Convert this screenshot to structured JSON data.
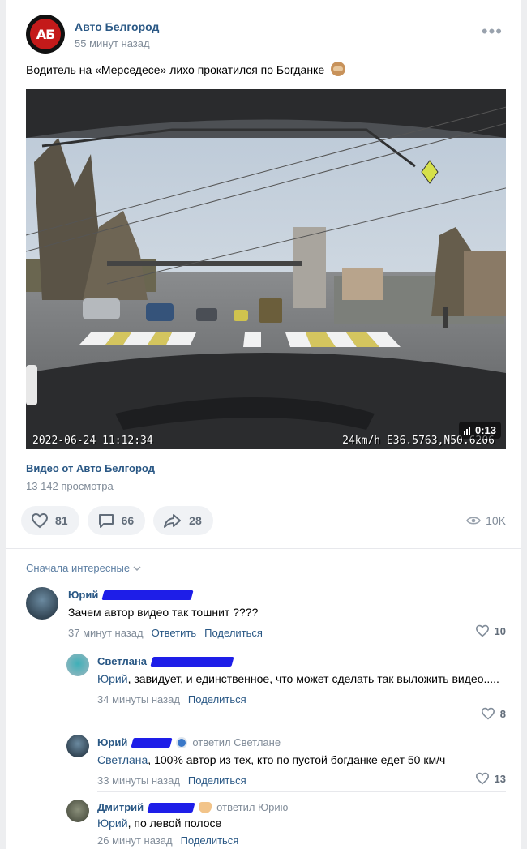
{
  "post": {
    "group_name": "Авто Белгород",
    "time": "55 минут назад",
    "avatar_text": "АБ",
    "text": "Водитель на «Мерседесе» лихо прокатился по Богданке",
    "emoji": "see-no-evil-monkey-icon"
  },
  "video": {
    "osd_date": "2022-06-24 11:12:34",
    "osd_gps": "24km/h E36.5763,N50.6206",
    "duration": "0:13",
    "title": "Видео от Авто Белгород",
    "views": "13 142 просмотра"
  },
  "actions": {
    "likes": "81",
    "comments": "66",
    "shares": "28",
    "views": "10K"
  },
  "comments_sort": "Сначала интересные",
  "comments": [
    {
      "author": "Юрий",
      "text": "Зачем автор видео так тошнит ????",
      "time": "37 минут назад",
      "reply": "Ответить",
      "share": "Поделиться",
      "likes": "10"
    },
    {
      "author": "Светлана",
      "mention": "Юрий",
      "text": ", завидует, и единственное, что может сделать так выложить видео.....",
      "time": "34 минуты назад",
      "share": "Поделиться",
      "likes": "8"
    },
    {
      "author": "Юрий",
      "replied_to": "ответил Светлане",
      "mention": "Светлана",
      "text": ", 100% автор из тех, кто по пустой богданке едет 50 км/ч",
      "time": "33 минуты назад",
      "share": "Поделиться",
      "likes": "13"
    },
    {
      "author": "Дмитрий",
      "replied_to": "ответил Юрию",
      "mention": "Юрий",
      "text": ", по левой полосе",
      "time": "26 минут назад",
      "share": "Поделиться"
    }
  ],
  "colors": {
    "link": "#2a5885",
    "muted": "#818c99",
    "scribble": "#1e1ee8",
    "brand_red": "#c41a1a"
  }
}
